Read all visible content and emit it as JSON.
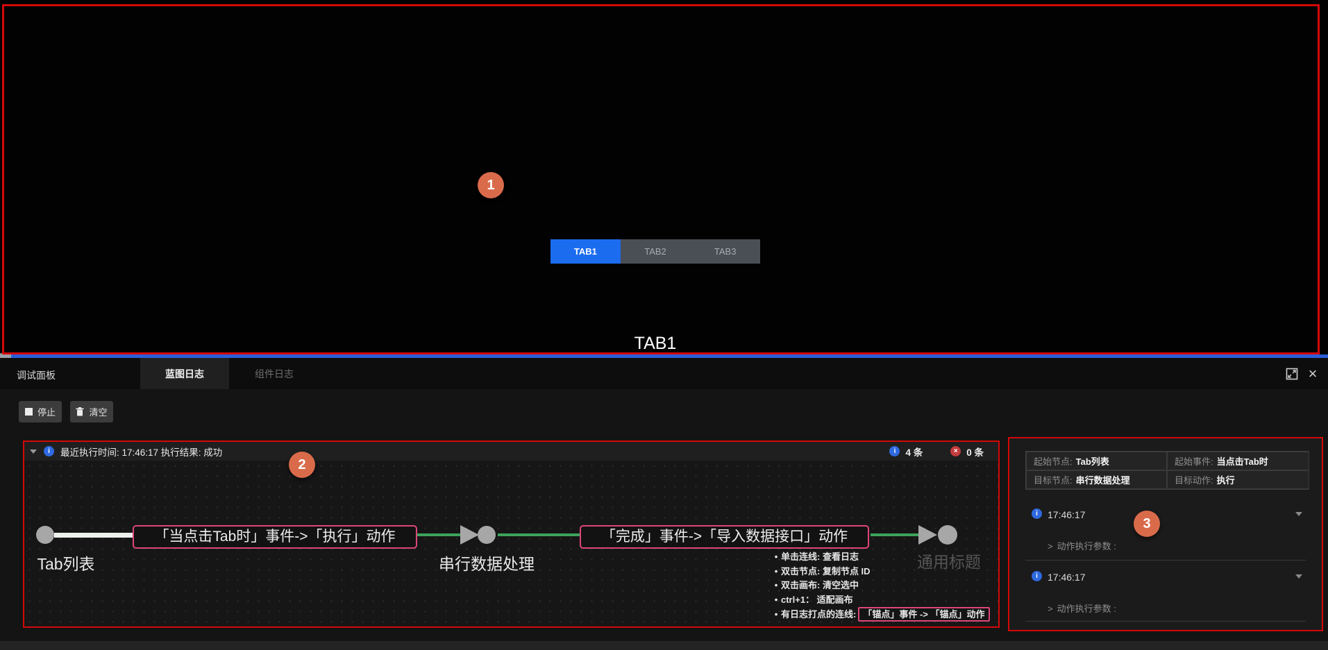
{
  "colors": {
    "annotation_red": "#d40808",
    "annotation_circle_orange": "#d96b4b",
    "active_tab_blue": "#1c6cf0",
    "splitter_blue": "#2b5ed8",
    "edge_green": "#3da35b",
    "edge_label_pink": "#dd4679",
    "info_blue": "#2e69e0",
    "error_red": "#c23c3c"
  },
  "annotations": {
    "one": "1",
    "two": "2",
    "three": "3"
  },
  "stage": {
    "tabs": [
      "TAB1",
      "TAB2",
      "TAB3"
    ],
    "active_tab": "TAB1",
    "caption": "TAB1"
  },
  "panel": {
    "title": "调试面板",
    "tab_blueprint_log": "蓝图日志",
    "tab_component_log": "组件日志",
    "toolbar": {
      "stop_label": "停止",
      "clear_label": "清空"
    },
    "log_header": {
      "summary": "最近执行时间: 17:46:17 执行结果: 成功",
      "info_count": "4 条",
      "error_count": "0 条"
    },
    "flow": {
      "node_start": "Tab列表",
      "edge1_label": "「当点击Tab时」事件->「执行」动作",
      "node_mid": "串行数据处理",
      "edge2_label": "「完成」事件->「导入数据接口」动作",
      "node_end": "通用标题"
    },
    "legend": {
      "items": [
        "单击连线: 查看日志",
        "双击节点: 复制节点 ID",
        "双击画布: 清空选中",
        "ctrl+1： 适配画布"
      ],
      "last_prefix": "有日志打点的连线:",
      "last_boxed": "「锚点」事件 -> 「锚点」动作"
    },
    "detail": {
      "table": [
        {
          "label": "起始节点:",
          "value": "Tab列表"
        },
        {
          "label": "起始事件:",
          "value": "当点击Tab时"
        },
        {
          "label": "目标节点:",
          "value": "串行数据处理"
        },
        {
          "label": "目标动作:",
          "value": "执行"
        }
      ],
      "entries": [
        {
          "time": "17:46:17",
          "params_label": "动作执行参数 :"
        },
        {
          "time": "17:46:17",
          "params_label": "动作执行参数 :"
        }
      ]
    }
  }
}
